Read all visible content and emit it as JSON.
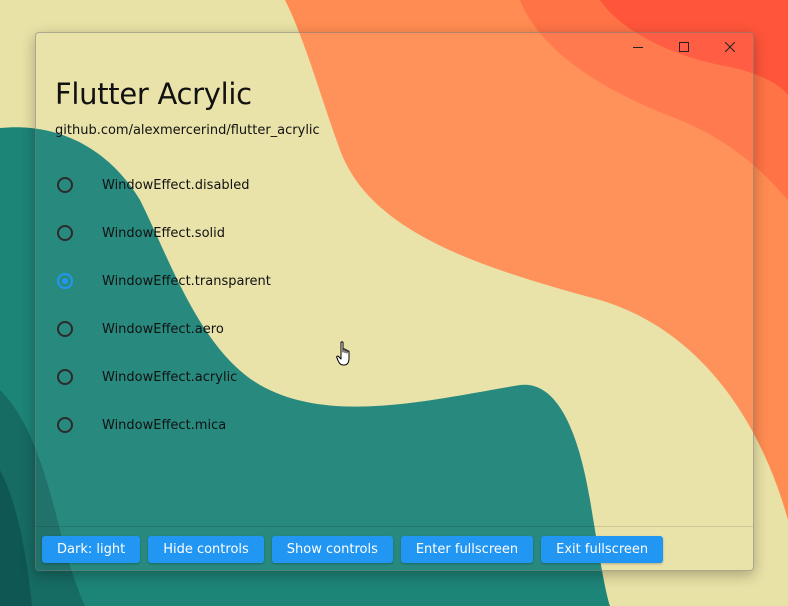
{
  "window": {
    "caption_icons": [
      "minimize-icon",
      "maximize-icon",
      "close-icon"
    ]
  },
  "header": {
    "title": "Flutter Acrylic",
    "subtitle": "github.com/alexmercerind/flutter_acrylic"
  },
  "effects": [
    {
      "label": "WindowEffect.disabled",
      "selected": false
    },
    {
      "label": "WindowEffect.solid",
      "selected": false
    },
    {
      "label": "WindowEffect.transparent",
      "selected": true
    },
    {
      "label": "WindowEffect.aero",
      "selected": false
    },
    {
      "label": "WindowEffect.acrylic",
      "selected": false
    },
    {
      "label": "WindowEffect.mica",
      "selected": false
    }
  ],
  "buttons": {
    "dark_light": "Dark: light",
    "hide_controls": "Hide controls",
    "show_controls": "Show controls",
    "enter_fullscreen": "Enter fullscreen",
    "exit_fullscreen": "Exit fullscreen"
  },
  "colors": {
    "accent": "#2196f3",
    "wallpaper_cream": "#e8e2a6",
    "wallpaper_orange": "#ff8c52",
    "wallpaper_red": "#ff5a3c",
    "wallpaper_teal": "#1d8478"
  }
}
